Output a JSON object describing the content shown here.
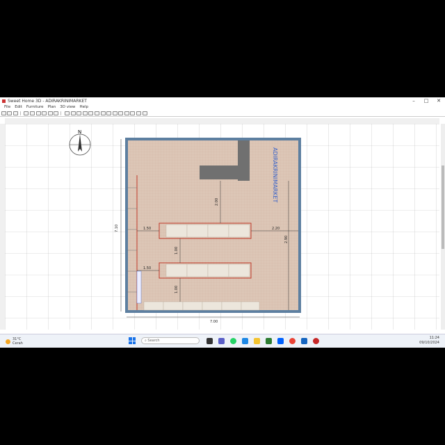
{
  "window": {
    "title": "Sweet Home 3D - ADIRAKRINIMARKET",
    "minimize": "–",
    "maximize": "□",
    "close": "✕"
  },
  "menu": [
    "File",
    "Edit",
    "Furniture",
    "Plan",
    "3D view",
    "Help"
  ],
  "plan": {
    "store_label": "ADIRAKRINIMARKET",
    "dimensions": {
      "width_bottom": "7.00",
      "height_left": "7.10",
      "top_gap": "2.00",
      "right_gap": "2.20",
      "right_side": "2.90",
      "aisle_gap_1": "1.00",
      "aisle_gap_2": "1.00",
      "left_1": "1.50",
      "left_2": "1.50"
    },
    "compass_label": "N"
  },
  "taskbar": {
    "weather_temp": "31°C",
    "weather_desc": "Cerah",
    "search_placeholder": "Search",
    "time": "11:24",
    "date": "09/10/2024"
  },
  "colors": {
    "floor": "#dcc6b6",
    "wall": "#5d7fa0",
    "counter": "#707070",
    "shelf": "#ece6dc",
    "shelf_outline": "#c0392b",
    "label": "#3a63c9"
  }
}
